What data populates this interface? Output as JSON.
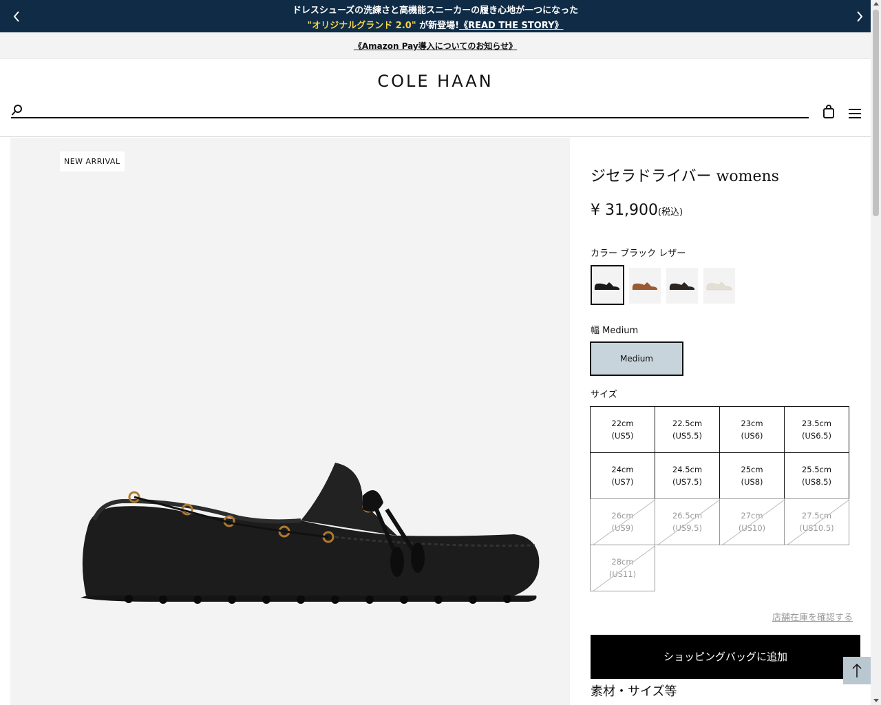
{
  "promo": {
    "line1": "ドレスシューズの洗練さと高機能スニーカーの履き心地が一つになった",
    "highlight": "\"オリジナルグランド 2.0\"",
    "line2_text": " が新登場!",
    "story_link": "《READ THE STORY》",
    "bg_color": "#0f2b46",
    "highlight_color": "#f3d44a"
  },
  "notice": {
    "link": "《Amazon Pay導入についてのお知らせ》"
  },
  "header": {
    "logo": "COLE HAAN",
    "search_placeholder": "",
    "icons": [
      "search-icon",
      "shopping-bag-icon",
      "hamburger-menu-icon"
    ]
  },
  "product": {
    "badge": "NEW ARRIVAL",
    "title": "ジセラドライバー womens",
    "price": "¥ 31,900",
    "tax_note": "(税込)",
    "color_label": "カラー ブラック レザー",
    "swatches": [
      {
        "name": "ブラック レザー",
        "color": "#1a1a1a",
        "selected": true
      },
      {
        "name": "brown",
        "color": "#9a5a32",
        "selected": false
      },
      {
        "name": "dark-brown",
        "color": "#2c2520",
        "selected": false
      },
      {
        "name": "white",
        "color": "#eeeae2",
        "selected": false
      }
    ],
    "width_label": "幅 Medium",
    "width_option": "Medium",
    "size_label": "サイズ",
    "sizes": [
      {
        "cm": "22cm",
        "us": "(US5)",
        "available": true
      },
      {
        "cm": "22.5cm",
        "us": "(US5.5)",
        "available": true
      },
      {
        "cm": "23cm",
        "us": "(US6)",
        "available": true
      },
      {
        "cm": "23.5cm",
        "us": "(US6.5)",
        "available": true
      },
      {
        "cm": "24cm",
        "us": "(US7)",
        "available": true
      },
      {
        "cm": "24.5cm",
        "us": "(US7.5)",
        "available": true
      },
      {
        "cm": "25cm",
        "us": "(US8)",
        "available": true
      },
      {
        "cm": "25.5cm",
        "us": "(US8.5)",
        "available": true
      },
      {
        "cm": "26cm",
        "us": "(US9)",
        "available": false
      },
      {
        "cm": "26.5cm",
        "us": "(US9.5)",
        "available": false
      },
      {
        "cm": "27cm",
        "us": "(US10)",
        "available": false
      },
      {
        "cm": "27.5cm",
        "us": "(US10.5)",
        "available": false
      },
      {
        "cm": "28cm",
        "us": "(US11)",
        "available": false
      }
    ],
    "store_stock_link": "店舗在庫を確認する",
    "add_to_bag": "ショッピングバッグに追加",
    "details_heading": "素材・サイズ等"
  }
}
